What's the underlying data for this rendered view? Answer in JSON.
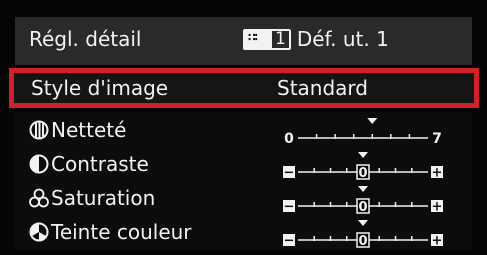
{
  "header": {
    "title": "Régl. détail",
    "style_number": "1",
    "style_name": "Déf. ut. 1"
  },
  "selected_row": {
    "label": "Style d'image",
    "value": "Standard"
  },
  "params": [
    {
      "label": "Netteté",
      "icon": "sharpness-icon",
      "min_label": "0",
      "max_label": "7",
      "current": 4,
      "steps": 7,
      "signed": false
    },
    {
      "label": "Contraste",
      "icon": "contrast-icon",
      "min_label": "−",
      "max_label": "+",
      "current": 0,
      "steps": 8,
      "signed": true
    },
    {
      "label": "Saturation",
      "icon": "saturation-icon",
      "min_label": "−",
      "max_label": "+",
      "current": 0,
      "steps": 8,
      "signed": true
    },
    {
      "label": "Teinte couleur",
      "icon": "color-tone-icon",
      "min_label": "−",
      "max_label": "+",
      "current": 0,
      "steps": 8,
      "signed": true
    }
  ],
  "colors": {
    "accent_red": "#d0202c",
    "text": "#f2f2f2",
    "header_bg": "#2a2a2a"
  }
}
